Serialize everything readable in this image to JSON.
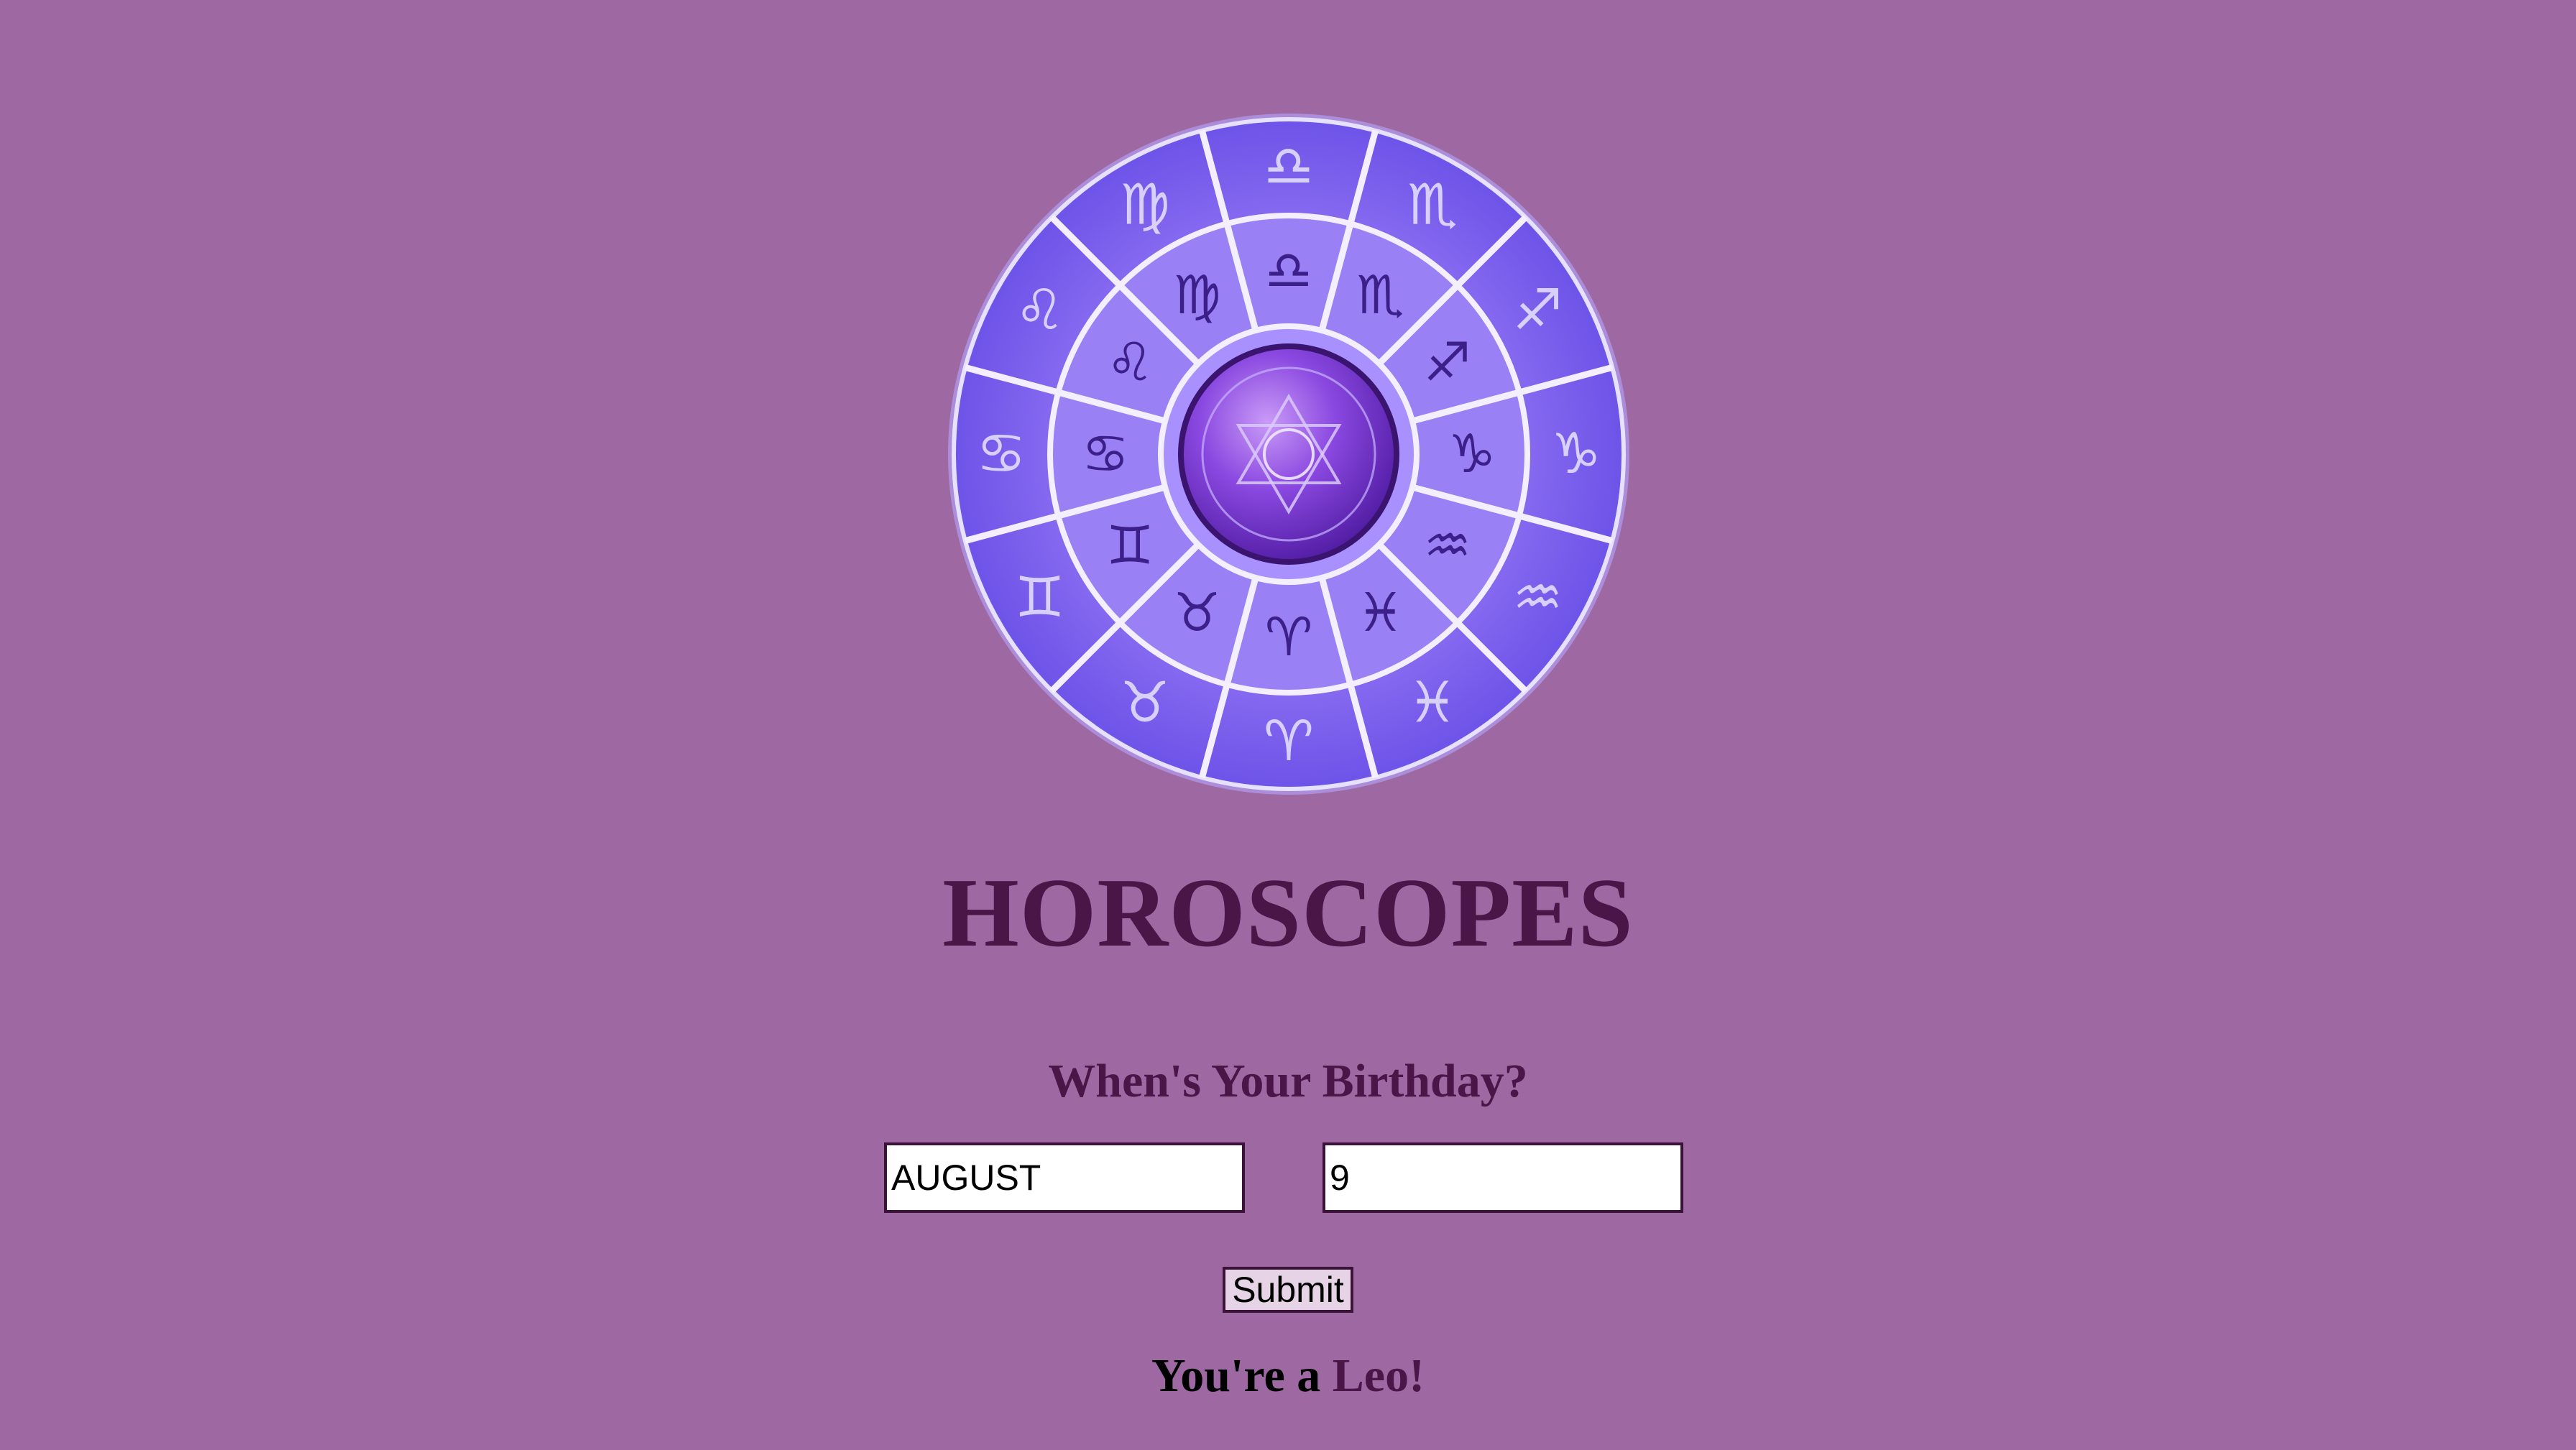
{
  "page": {
    "background": "#9e68a3",
    "accent": "#4a1547"
  },
  "wheel": {
    "icon": "zodiac-wheel-icon",
    "inner_symbols": [
      "♈",
      "♉",
      "♊",
      "♋",
      "♌",
      "♍",
      "♎",
      "♏",
      "♐",
      "♑",
      "♒",
      "♓"
    ],
    "outer_symbols": [
      "♈",
      "♉",
      "♊",
      "♋",
      "♌",
      "♍",
      "♎",
      "♏",
      "♐",
      "♑",
      "♒",
      "♓"
    ]
  },
  "header": {
    "title": "HOROSCOPES"
  },
  "form": {
    "question": "When's Your Birthday?",
    "month_value": "AUGUST",
    "day_value": "9",
    "submit_label": "Submit"
  },
  "result": {
    "prefix": "You're a ",
    "sign": "Leo!"
  }
}
